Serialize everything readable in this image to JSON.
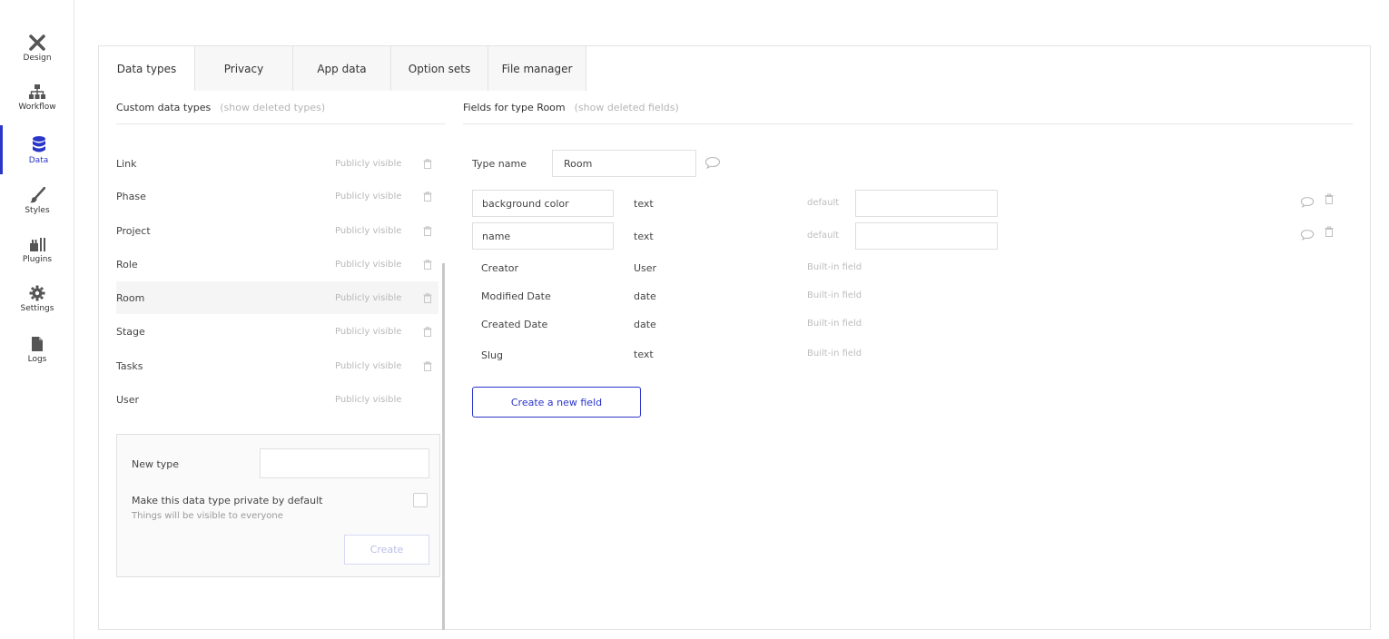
{
  "sidebar": {
    "items": [
      {
        "label": "Design",
        "icon": "design-icon"
      },
      {
        "label": "Workflow",
        "icon": "workflow-icon"
      },
      {
        "label": "Data",
        "icon": "database-icon"
      },
      {
        "label": "Styles",
        "icon": "brush-icon"
      },
      {
        "label": "Plugins",
        "icon": "plug-icon"
      },
      {
        "label": "Settings",
        "icon": "gear-icon"
      },
      {
        "label": "Logs",
        "icon": "document-icon"
      }
    ],
    "active_index": 2
  },
  "tabs": [
    "Data types",
    "Privacy",
    "App data",
    "Option sets",
    "File manager"
  ],
  "left": {
    "heading": "Custom data types",
    "show_deleted": "(show deleted types)",
    "types": [
      {
        "name": "Link",
        "visibility": "Publicly visible",
        "deletable": true
      },
      {
        "name": "Phase",
        "visibility": "Publicly visible",
        "deletable": true
      },
      {
        "name": "Project",
        "visibility": "Publicly visible",
        "deletable": true
      },
      {
        "name": "Role",
        "visibility": "Publicly visible",
        "deletable": true
      },
      {
        "name": "Room",
        "visibility": "Publicly visible",
        "deletable": true
      },
      {
        "name": "Stage",
        "visibility": "Publicly visible",
        "deletable": true
      },
      {
        "name": "Tasks",
        "visibility": "Publicly visible",
        "deletable": true
      },
      {
        "name": "User",
        "visibility": "Publicly visible",
        "deletable": false
      }
    ],
    "selected": "Room",
    "new_type": {
      "label": "New type",
      "value": "",
      "private_label": "Make this data type private by default",
      "private_sub": "Things will be visible to everyone",
      "private_checked": false,
      "create_label": "Create"
    }
  },
  "right": {
    "heading": "Fields for type Room",
    "show_deleted": "(show deleted fields)",
    "type_name_label": "Type name",
    "type_name_value": "Room",
    "fields": [
      {
        "name": "background color",
        "type": "text",
        "default_label": "default",
        "default_value": ""
      },
      {
        "name": "name",
        "type": "text",
        "default_label": "default",
        "default_value": ""
      }
    ],
    "builtin": [
      {
        "name": "Creator",
        "type": "User",
        "label": "Built-in field"
      },
      {
        "name": "Modified Date",
        "type": "date",
        "label": "Built-in field"
      },
      {
        "name": "Created Date",
        "type": "date",
        "label": "Built-in field"
      },
      {
        "name": "Slug",
        "type": "text",
        "label": "Built-in field"
      }
    ],
    "create_field_label": "Create a new field"
  },
  "colors": {
    "accent": "#2a35c9",
    "muted_text": "#b5b5b5",
    "border": "#e3e3e3"
  }
}
